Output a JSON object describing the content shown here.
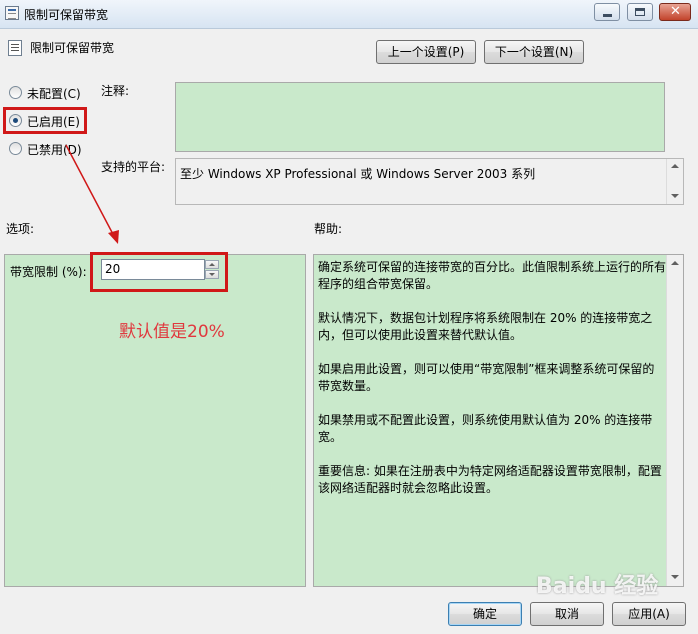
{
  "window": {
    "title": "限制可保留带宽"
  },
  "header": {
    "policy_title": "限制可保留带宽",
    "prev_button": "上一个设置(P)",
    "next_button": "下一个设置(N)"
  },
  "state": {
    "not_configured": "未配置(C)",
    "enabled": "已启用(E)",
    "disabled": "已禁用(D)",
    "selected": "enabled"
  },
  "comment": {
    "label": "注释:",
    "value": ""
  },
  "platform": {
    "label": "支持的平台:",
    "value": "至少 Windows XP Professional 或 Windows Server 2003 系列"
  },
  "options": {
    "heading": "选项:",
    "bandwidth_label": "带宽限制 (%):",
    "bandwidth_value": "20"
  },
  "help": {
    "heading": "帮助:",
    "paragraphs": [
      "确定系统可保留的连接带宽的百分比。此值限制系统上运行的所有程序的组合带宽保留。",
      "默认情况下，数据包计划程序将系统限制在 20% 的连接带宽之内，但可以使用此设置来替代默认值。",
      "如果启用此设置，则可以使用“带宽限制”框来调整系统可保留的带宽数量。",
      "如果禁用或不配置此设置，则系统使用默认值为 20% 的连接带宽。",
      "重要信息: 如果在注册表中为特定网络适配器设置带宽限制，配置该网络适配器时就会忽略此设置。"
    ]
  },
  "annotation": {
    "text": "默认值是20%",
    "color": "#e0383e"
  },
  "footer": {
    "ok": "确定",
    "cancel": "取消",
    "apply": "应用(A)"
  },
  "watermark": {
    "text": "Baidu 经验"
  },
  "colors": {
    "panel_green": "#c9e9cb",
    "highlight_red": "#d01818"
  }
}
